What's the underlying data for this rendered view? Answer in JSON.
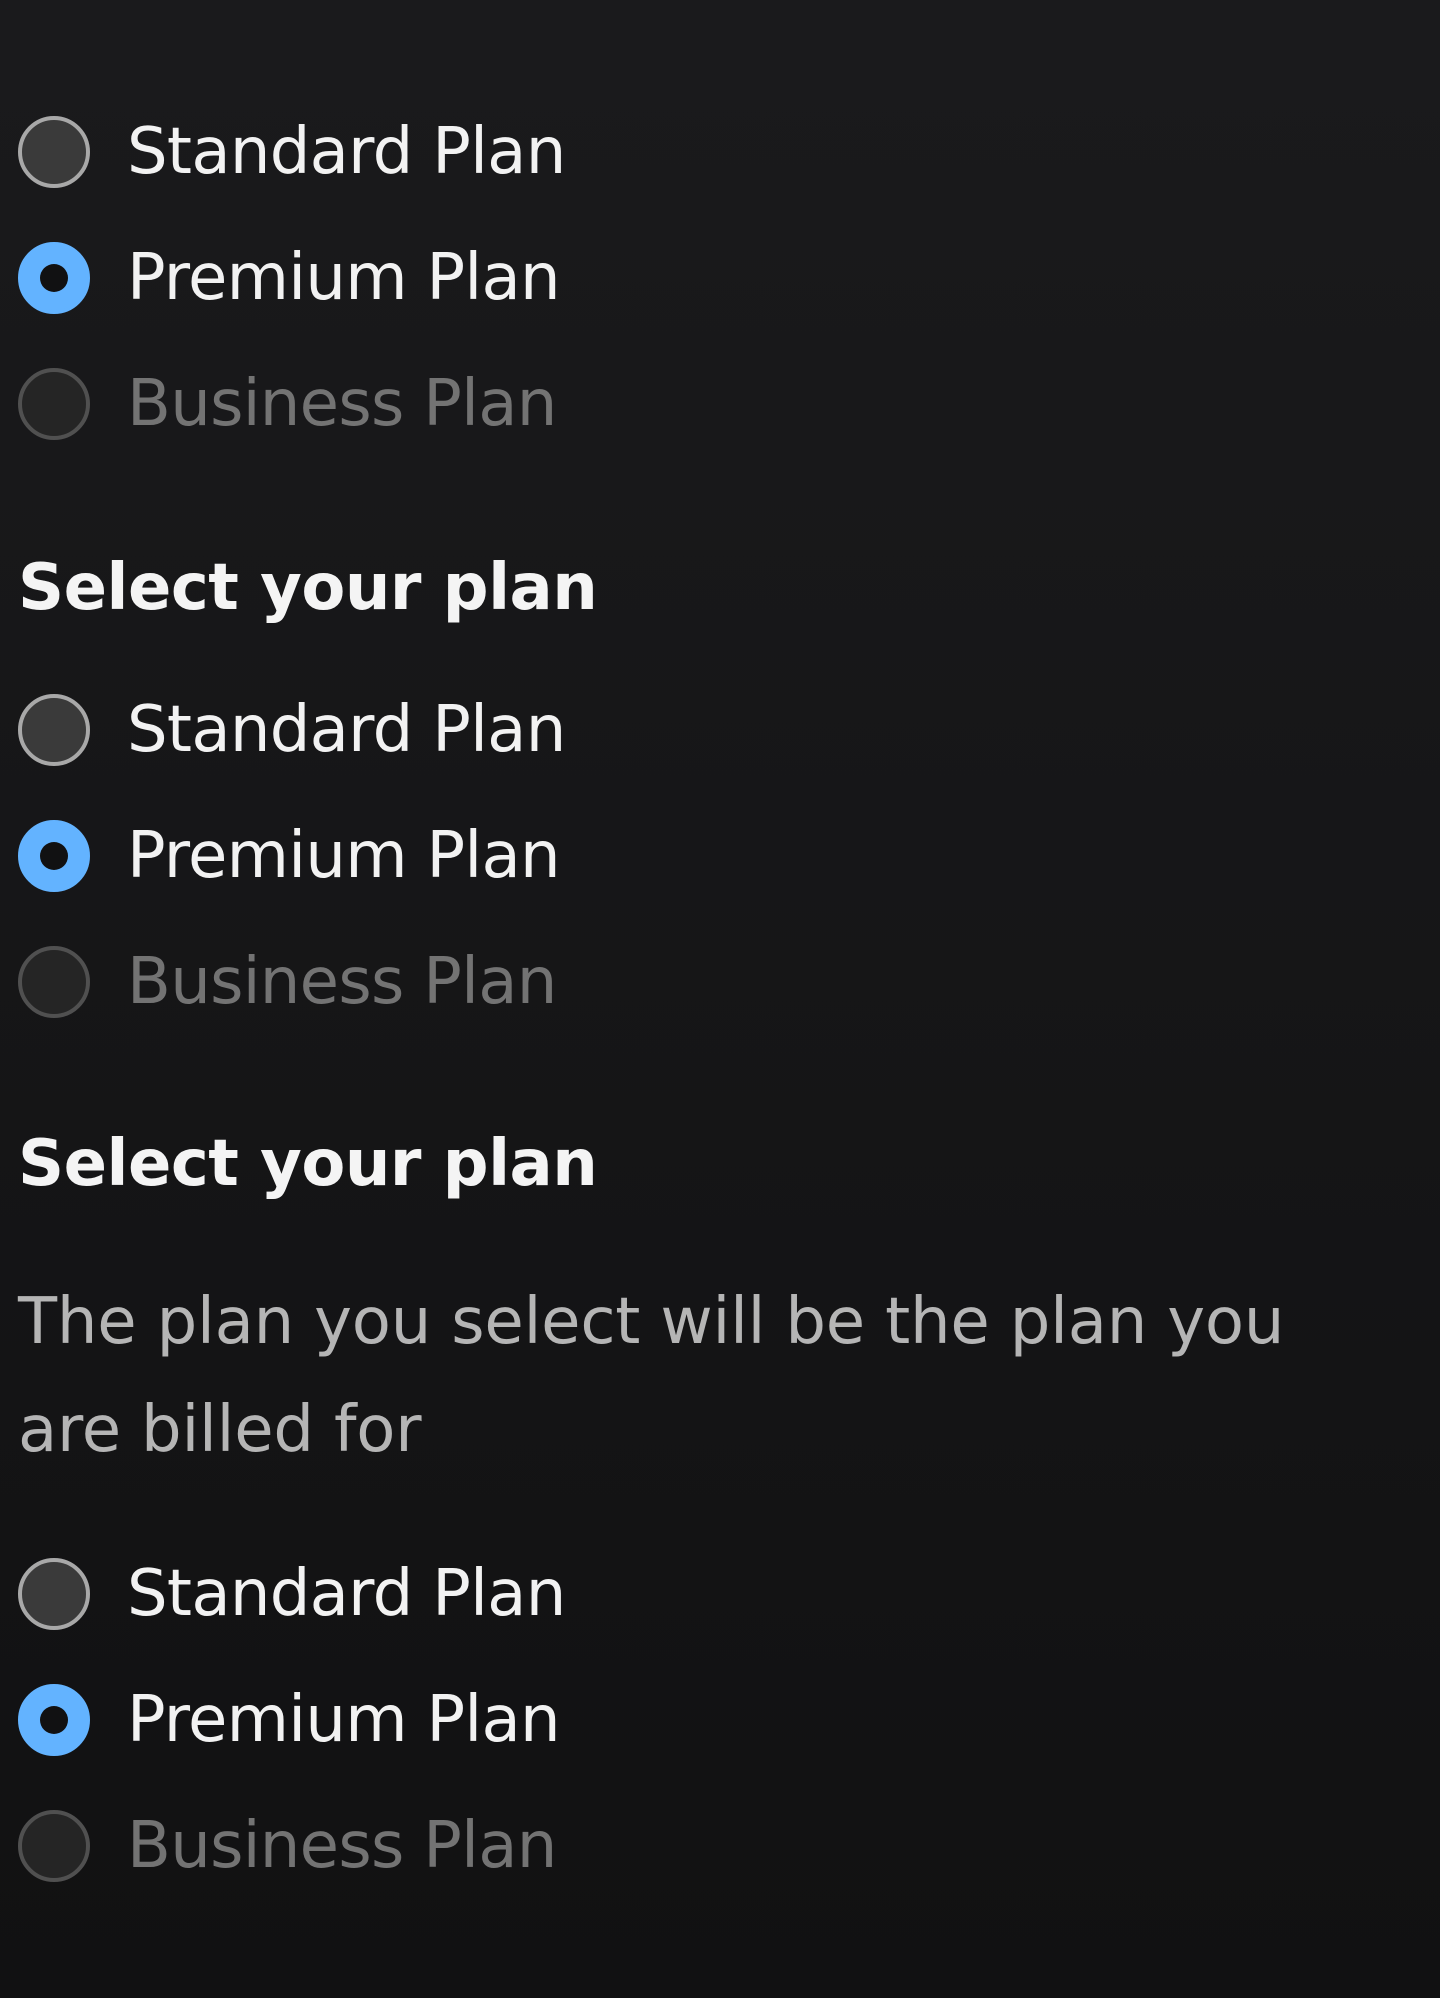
{
  "theme": {
    "background": "#141415",
    "text": "#f2f2f2",
    "muted_text": "#b5b5b5",
    "disabled_text": "#737373",
    "accent": "#63b3ff"
  },
  "groups": [
    {
      "heading": "",
      "description": "",
      "options": [
        {
          "label": "Standard Plan",
          "state": "unchecked"
        },
        {
          "label": "Premium Plan",
          "state": "checked"
        },
        {
          "label": "Business Plan",
          "state": "disabled"
        }
      ]
    },
    {
      "heading": "Select your plan",
      "description": "",
      "options": [
        {
          "label": "Standard Plan",
          "state": "unchecked"
        },
        {
          "label": "Premium Plan",
          "state": "checked"
        },
        {
          "label": "Business Plan",
          "state": "disabled"
        }
      ]
    },
    {
      "heading": "Select your plan",
      "description": "The plan you select will be the plan you are billed for",
      "options": [
        {
          "label": "Standard Plan",
          "state": "unchecked"
        },
        {
          "label": "Premium Plan",
          "state": "checked"
        },
        {
          "label": "Business Plan",
          "state": "disabled"
        }
      ]
    }
  ]
}
